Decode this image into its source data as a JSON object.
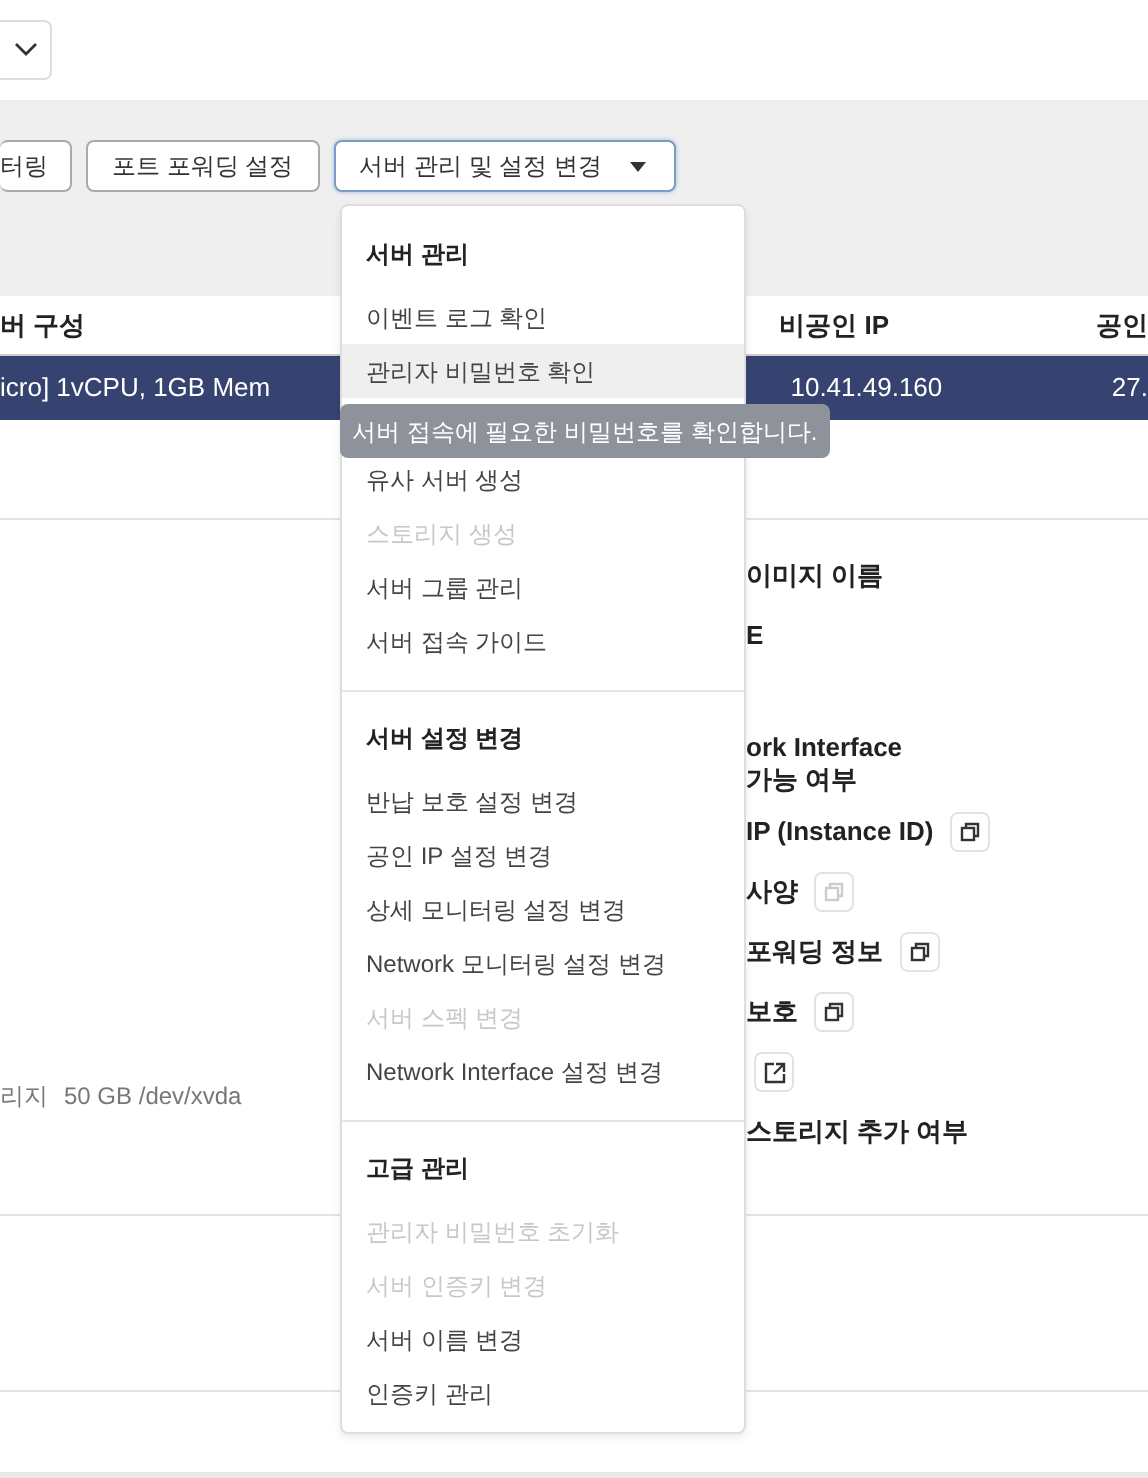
{
  "toolbar": {
    "buttons": [
      {
        "label": "터링",
        "kind": "plain",
        "expanded": false
      },
      {
        "label": "포트 포워딩 설정",
        "kind": "plain",
        "expanded": false
      },
      {
        "label": "서버 관리 및 설정 변경",
        "kind": "dropdown",
        "expanded": true
      }
    ]
  },
  "table": {
    "columns": [
      "버 구성",
      "비공인 IP",
      "공인"
    ],
    "rows": [
      {
        "cells": [
          "icro] 1vCPU, 1GB Mem",
          "10.41.49.160",
          "27."
        ],
        "selected": true
      }
    ]
  },
  "details": {
    "left": [
      {
        "label": "리지",
        "value": "50 GB /dev/xvda"
      }
    ],
    "right": [
      {
        "kind": "label",
        "lines": [
          "이미지 이름"
        ]
      },
      {
        "kind": "label",
        "lines": [
          "E"
        ]
      },
      {
        "kind": "multiline",
        "lines": [
          "ork Interface",
          "가능 여부"
        ]
      },
      {
        "kind": "copy",
        "lines": [
          "IP (Instance ID)"
        ],
        "disabled": false
      },
      {
        "kind": "copy",
        "lines": [
          "사양"
        ],
        "disabled": true
      },
      {
        "kind": "copy",
        "lines": [
          "포워딩 정보"
        ],
        "disabled": false
      },
      {
        "kind": "copy",
        "lines": [
          "보호"
        ],
        "disabled": false
      },
      {
        "kind": "external",
        "disabled": false
      },
      {
        "kind": "label",
        "lines": [
          "스토리지 추가 여부"
        ]
      }
    ]
  },
  "menu": {
    "sections": [
      {
        "title": "서버 관리",
        "items": [
          {
            "label": "이벤트 로그 확인",
            "disabled": false,
            "highlighted": false
          },
          {
            "label": "관리자 비밀번호 확인",
            "disabled": false,
            "highlighted": true
          },
          {
            "label": "유사 서버 생성",
            "disabled": false,
            "highlighted": false
          },
          {
            "label": "스토리지 생성",
            "disabled": true,
            "highlighted": false
          },
          {
            "label": "서버 그룹 관리",
            "disabled": false,
            "highlighted": false
          },
          {
            "label": "서버 접속 가이드",
            "disabled": false,
            "highlighted": false
          }
        ]
      },
      {
        "title": "서버 설정 변경",
        "items": [
          {
            "label": "반납 보호 설정 변경",
            "disabled": false,
            "highlighted": false
          },
          {
            "label": "공인 IP 설정 변경",
            "disabled": false,
            "highlighted": false
          },
          {
            "label": "상세 모니터링 설정 변경",
            "disabled": false,
            "highlighted": false
          },
          {
            "label": "Network 모니터링 설정 변경",
            "disabled": false,
            "highlighted": false
          },
          {
            "label": "서버 스펙 변경",
            "disabled": true,
            "highlighted": false
          },
          {
            "label": "Network Interface 설정 변경",
            "disabled": false,
            "highlighted": false
          }
        ]
      },
      {
        "title": "고급 관리",
        "items": [
          {
            "label": "관리자 비밀번호 초기화",
            "disabled": true,
            "highlighted": false
          },
          {
            "label": "서버 인증키 변경",
            "disabled": true,
            "highlighted": false
          },
          {
            "label": "서버 이름 변경",
            "disabled": false,
            "highlighted": false
          },
          {
            "label": "인증키 관리",
            "disabled": false,
            "highlighted": false
          }
        ]
      }
    ]
  },
  "tooltip": {
    "text": "서버 접속에 필요한 비밀번호를 확인합니다."
  }
}
